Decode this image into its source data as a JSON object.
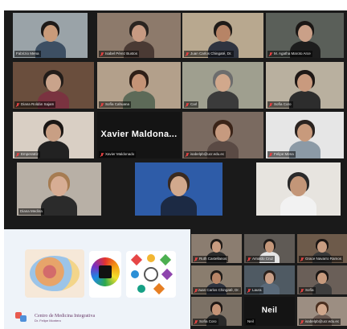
{
  "meeting": {
    "participants": [
      {
        "id": "p1",
        "name": "Fabrizio Mena",
        "muted": false,
        "speaking": false,
        "video": true,
        "bg": "#9aa3a8",
        "skin": "#c99b7a",
        "hair": "#1e1a18",
        "shirt": "#3d4f63"
      },
      {
        "id": "p2",
        "name": "Isabel Pérez Bustos",
        "muted": true,
        "speaking": false,
        "video": true,
        "bg": "#8d7a6b",
        "skin": "#c79a82",
        "hair": "#2a2420",
        "shirt": "#4a3a34"
      },
      {
        "id": "p3",
        "name": "Juan Carlos Chingaté, Dr.",
        "muted": true,
        "speaking": false,
        "video": true,
        "bg": "#b8a88f",
        "skin": "#b78466",
        "hair": "#1f1b18",
        "shirt": "#2f3440"
      },
      {
        "id": "p4",
        "name": "M. Agatha Maroto Arce",
        "muted": true,
        "speaking": true,
        "video": true,
        "bg": "#5a5f59",
        "skin": "#caa088",
        "hair": "#1b1715",
        "shirt": "#1d1d1d"
      },
      {
        "id": "p5",
        "name": "Diana Roldán Sajam",
        "muted": true,
        "speaking": false,
        "video": true,
        "bg": "#6a4e3d",
        "skin": "#c9a38b",
        "hair": "#221c19",
        "shirt": "#7a3340"
      },
      {
        "id": "p6",
        "name": "Sofía Cahuana",
        "muted": true,
        "speaking": false,
        "video": true,
        "bg": "#b3a08b",
        "skin": "#c49376",
        "hair": "#2e1f17",
        "shirt": "#5d6a58"
      },
      {
        "id": "p7",
        "name": "Carl",
        "muted": true,
        "speaking": false,
        "video": true,
        "bg": "#9f9f8f",
        "skin": "#d1a88c",
        "hair": "#6d6d6d",
        "shirt": "#3b3b3b"
      },
      {
        "id": "p8",
        "name": "Sofía Coro",
        "muted": true,
        "speaking": false,
        "video": true,
        "bg": "#b9b09f",
        "skin": "#c99a7e",
        "hair": "#1f1816",
        "shirt": "#2d2d2d"
      },
      {
        "id": "p9",
        "name": "Emperatriz",
        "muted": true,
        "speaking": false,
        "video": true,
        "bg": "#d9cfc4",
        "skin": "#c89f84",
        "hair": "#1a1614",
        "shirt": "#222"
      },
      {
        "id": "p10",
        "name": "Xavier Maldonado",
        "muted": true,
        "speaking": false,
        "video": false,
        "display": "Xavier Maldona..."
      },
      {
        "id": "p11",
        "name": "isabelpb@ucr.edu.ec",
        "muted": true,
        "speaking": false,
        "video": true,
        "bg": "#7a6a60",
        "skin": "#c69a7f",
        "hair": "#3b2418",
        "shirt": "#5a4a44"
      },
      {
        "id": "p12",
        "name": "Felipe Mena",
        "muted": true,
        "speaking": false,
        "video": true,
        "bg": "#e6e6e6",
        "skin": "#c89a7c",
        "hair": "#2a2320",
        "shirt": "#8c9aa6"
      },
      {
        "id": "p13",
        "name": "Diana Medina",
        "muted": false,
        "speaking": false,
        "video": true,
        "bg": "#b8b0a6",
        "skin": "#d7ad94",
        "hair": "#a67c52",
        "shirt": "#2b2b2b"
      },
      {
        "id": "p14",
        "name": "",
        "muted": false,
        "speaking": false,
        "video": true,
        "bg": "#2e5ca8",
        "skin": "#d2a98d",
        "hair": "#3a2a20",
        "shirt": "#1c2a44"
      },
      {
        "id": "p15",
        "name": "",
        "muted": false,
        "speaking": false,
        "video": true,
        "bg": "#e7e4df",
        "skin": "#c39678",
        "hair": "#2a2a2a",
        "shirt": "#f2f2f2"
      },
      {
        "id": "s1",
        "name": "Ruth Castellanos",
        "muted": true,
        "video": true,
        "bg": "#8b7d70",
        "skin": "#c99c80",
        "hair": "#1f1a17",
        "shirt": "#2c2c2c"
      },
      {
        "id": "s2",
        "name": "Arnaldo Cruz",
        "muted": true,
        "video": true,
        "bg": "#5f5a55",
        "skin": "#c4977a",
        "hair": "#1e1a18",
        "shirt": "#e5e5e5"
      },
      {
        "id": "s3",
        "name": "Grace Navarro Ramos",
        "muted": true,
        "video": true,
        "bg": "#6d5a4a",
        "skin": "#c89d82",
        "hair": "#1c1614",
        "shirt": "#3a3a3a"
      },
      {
        "id": "s4",
        "name": "Juan Carlos Chingaté, Dr.",
        "muted": true,
        "video": true,
        "bg": "#8a7d6e",
        "skin": "#b78466",
        "hair": "#1f1b18",
        "shirt": "#2f3440"
      },
      {
        "id": "s5",
        "name": "Laura",
        "muted": true,
        "video": true,
        "bg": "#4f5a63",
        "skin": "#caa088",
        "hair": "#2a201b",
        "shirt": "#5a6a7a"
      },
      {
        "id": "s6",
        "name": "Sofía",
        "muted": true,
        "video": true,
        "bg": "#6a5f58",
        "skin": "#c69a7d",
        "hair": "#1a1614",
        "shirt": "#3d3d3d"
      },
      {
        "id": "s7",
        "name": "Sofía Coro",
        "muted": true,
        "video": true,
        "bg": "#7d7266",
        "skin": "#c49376",
        "hair": "#1e1714",
        "shirt": "#2a2a2a"
      },
      {
        "id": "s8",
        "name": "Neil",
        "muted": false,
        "video": false,
        "display": "Neil"
      },
      {
        "id": "s9",
        "name": "isabelpb@ucr.edu.ec",
        "muted": true,
        "video": true,
        "bg": "#9c8e82",
        "skin": "#d0a78c",
        "hair": "#4a2f1f",
        "shirt": "#6b5a52"
      }
    ]
  },
  "share": {
    "logo_title": "Centro de Medicina Integrativa",
    "logo_sub": "Dr. Felipe Montero",
    "colors": {
      "logo_primary": "#e85a4f",
      "logo_secondary": "#4f8fd9",
      "text": "#6b3c6b"
    }
  },
  "icons": {
    "muted": "mic-off-icon"
  }
}
